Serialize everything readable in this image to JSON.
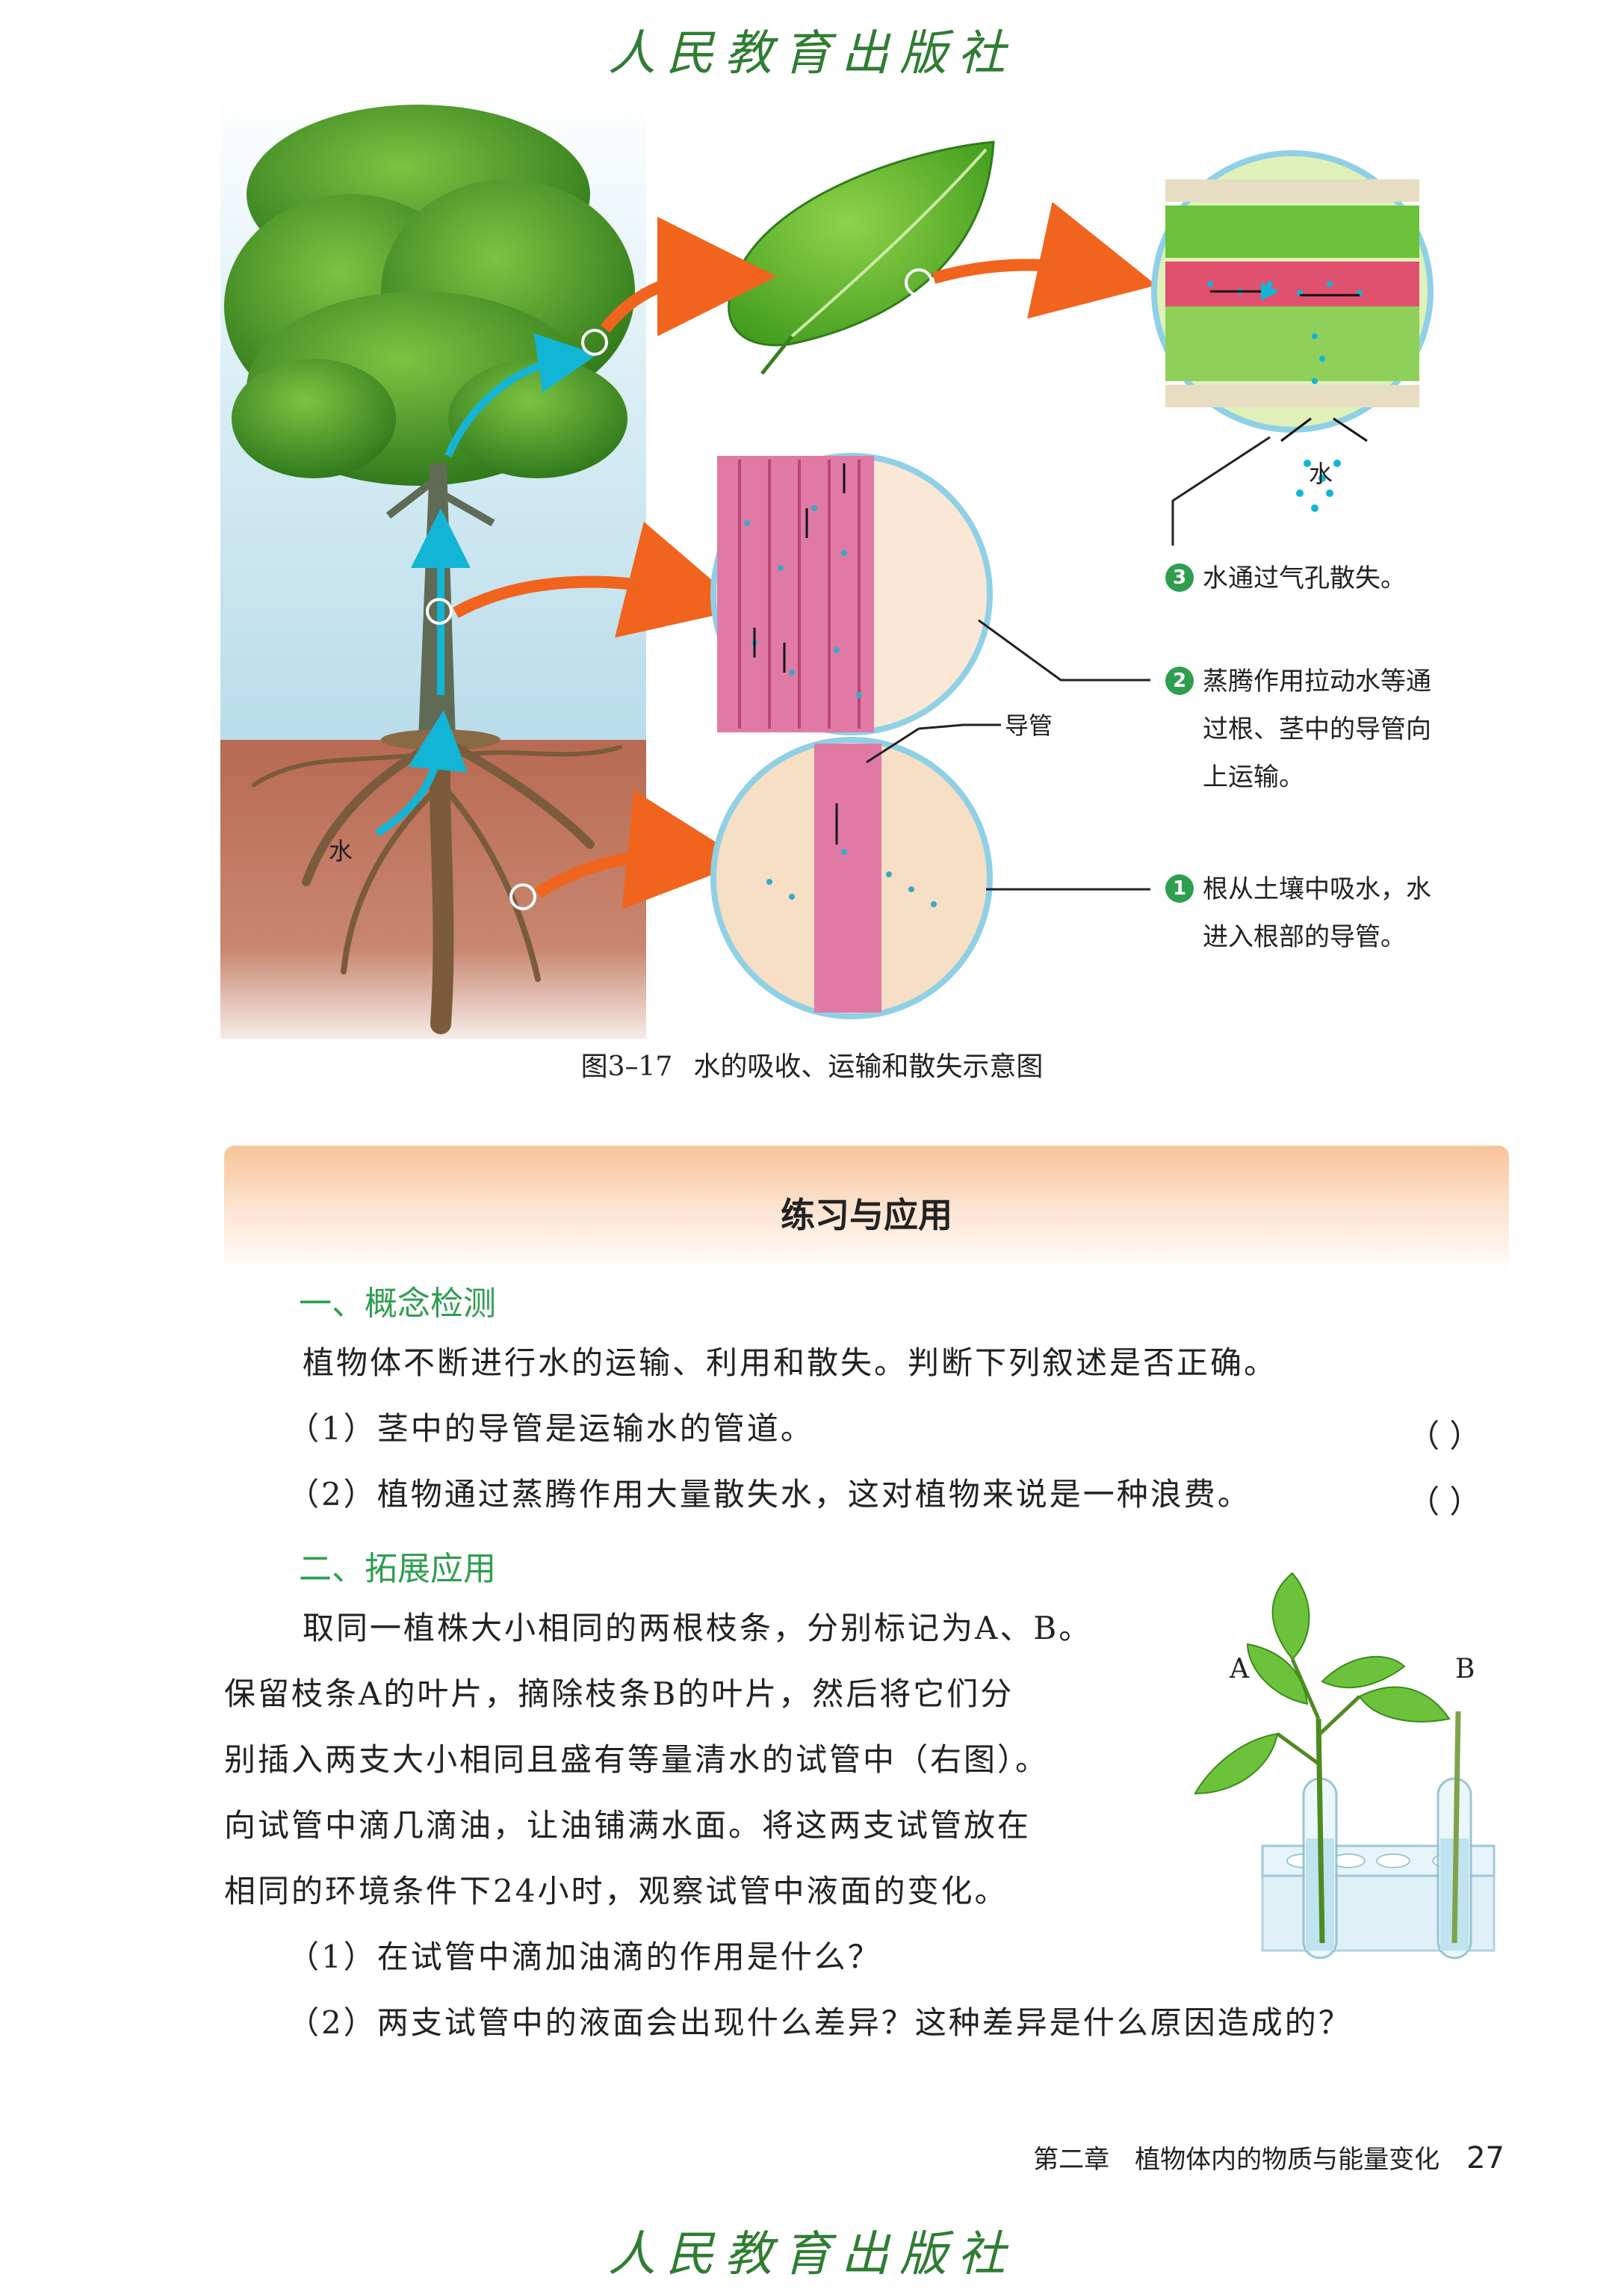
{
  "header": {
    "publisher": "人民教育出版社"
  },
  "figure": {
    "label_water": "水",
    "label_water_top": "水",
    "label_vessel": "导管",
    "caption_number": "图3–17",
    "caption_text": "水的吸收、运输和散失示意图",
    "callouts": [
      {
        "number": "3",
        "lines": [
          "水通过气孔散失。"
        ]
      },
      {
        "number": "2",
        "lines": [
          "蒸腾作用拉动水等通",
          "过根、茎中的导管向",
          "上运输。"
        ]
      },
      {
        "number": "1",
        "lines": [
          "根从土壤中吸水，水",
          "进入根部的导管。"
        ]
      }
    ]
  },
  "exercise": {
    "title": "练习与应用",
    "section1": {
      "heading": "一、概念检测",
      "intro": "植物体不断进行水的运输、利用和散失。判断下列叙述是否正确。",
      "items": [
        {
          "text": "（1）茎中的导管是运输水的管道。",
          "blank": "（    ）"
        },
        {
          "text": "（2）植物通过蒸腾作用大量散失水，这对植物来说是一种浪费。",
          "blank": "（    ）"
        }
      ]
    },
    "section2": {
      "heading": "二、拓展应用",
      "paragraph_lines": [
        "取同一植株大小相同的两根枝条，分别标记为A、B。",
        "保留枝条A的叶片，摘除枝条B的叶片，然后将它们分",
        "别插入两支大小相同且盛有等量清水的试管中（右图）。",
        "向试管中滴几滴油，让油铺满水面。将这两支试管放在",
        "相同的环境条件下24小时，观察试管中液面的变化。"
      ],
      "questions": [
        "（1）在试管中滴加油滴的作用是什么？",
        "（2）两支试管中的液面会出现什么差异？这种差异是什么原因造成的？"
      ],
      "label_a": "A",
      "label_b": "B"
    }
  },
  "footer": {
    "chapter": "第二章　植物体内的物质与能量变化",
    "page": "27"
  }
}
